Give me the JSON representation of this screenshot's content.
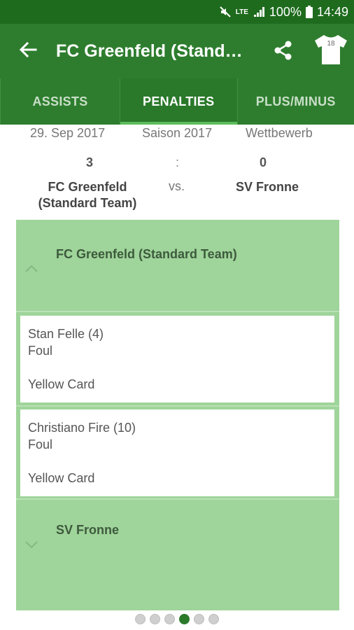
{
  "status_bar": {
    "network": "LTE",
    "battery": "100%",
    "time": "14:49",
    "icons": [
      "mute-icon",
      "signal-icon",
      "battery-icon"
    ]
  },
  "app_bar": {
    "title": "FC Greenfeld (Stand…",
    "jersey_number": "18",
    "icons": [
      "back-arrow-icon",
      "share-icon",
      "jersey-icon"
    ]
  },
  "tabs": [
    {
      "label": "ASSISTS",
      "active": false
    },
    {
      "label": "PENALTIES",
      "active": true
    },
    {
      "label": "PLUS/MINUS",
      "active": false
    }
  ],
  "match": {
    "date": "29. Sep 2017",
    "season": "Saison 2017",
    "competition": "Wettbewerb",
    "home_score": "3",
    "separator": ":",
    "away_score": "0",
    "home_team": "FC Greenfeld (Standard Team)",
    "vs": "vs.",
    "away_team": "SV Fronne"
  },
  "groups": [
    {
      "team": "FC Greenfeld (Standard Team)",
      "expanded": true,
      "penalties": [
        {
          "player": "Stan Felle (4)",
          "reason": "Foul",
          "card": "Yellow Card"
        },
        {
          "player": "Christiano Fire (10)",
          "reason": "Foul",
          "card": "Yellow Card"
        }
      ]
    },
    {
      "team": "SV Fronne",
      "expanded": false,
      "penalties": []
    }
  ],
  "pager": {
    "count": 6,
    "active_index": 3
  },
  "colors": {
    "status_bar": "#1e6b1e",
    "app_bar": "#2e7d2e",
    "panel": "#9fd49a",
    "tab_indicator": "#5bbd5b",
    "dot_active": "#2a7a2a"
  }
}
